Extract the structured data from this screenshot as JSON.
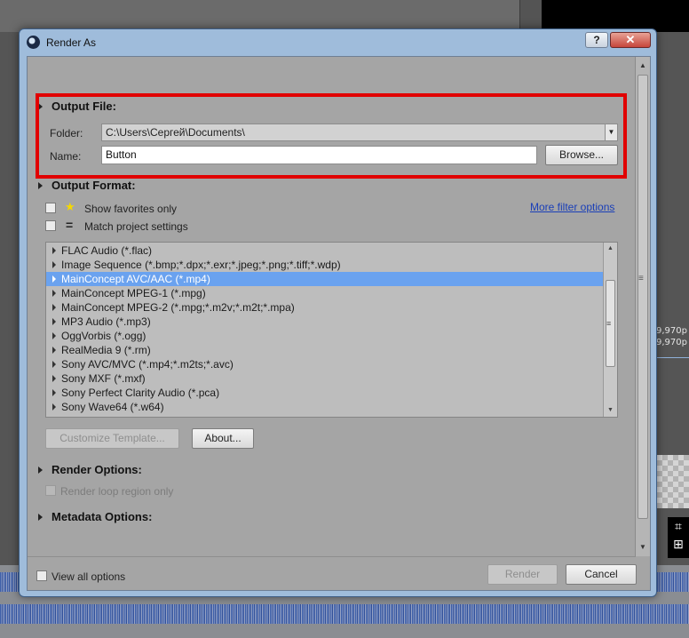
{
  "background": {
    "timecode_1": "9,970p",
    "timecode_2": "9,970p"
  },
  "dialog": {
    "title": "Render As",
    "help_label": "?",
    "close_label": "✕"
  },
  "output_file": {
    "heading": "Output File:",
    "folder_label": "Folder:",
    "folder_value": "C:\\Users\\Сергей\\Documents\\",
    "name_label": "Name:",
    "name_value": "Button",
    "browse_label": "Browse..."
  },
  "output_format": {
    "heading": "Output Format:",
    "show_favorites_label": "Show favorites only",
    "match_project_label": "Match project settings",
    "more_filter_label": "More filter options",
    "formats": [
      "FLAC Audio (*.flac)",
      "Image Sequence (*.bmp;*.dpx;*.exr;*.jpeg;*.png;*.tiff;*.wdp)",
      "MainConcept AVC/AAC (*.mp4)",
      "MainConcept MPEG-1 (*.mpg)",
      "MainConcept MPEG-2 (*.mpg;*.m2v;*.m2t;*.mpa)",
      "MP3 Audio (*.mp3)",
      "OggVorbis (*.ogg)",
      "RealMedia 9 (*.rm)",
      "Sony AVC/MVC (*.mp4;*.m2ts;*.avc)",
      "Sony MXF (*.mxf)",
      "Sony Perfect Clarity Audio (*.pca)",
      "Sony Wave64 (*.w64)"
    ],
    "selected_index": 2,
    "customize_label": "Customize Template...",
    "about_label": "About..."
  },
  "render_options": {
    "heading": "Render Options:",
    "loop_label": "Render loop region only"
  },
  "metadata_options": {
    "heading": "Metadata Options:"
  },
  "footer": {
    "view_all_label": "View all options",
    "render_label": "Render",
    "cancel_label": "Cancel"
  },
  "colors": {
    "highlight": "#e10000",
    "selection": "#6aa2ef",
    "link": "#1a3fb8"
  }
}
